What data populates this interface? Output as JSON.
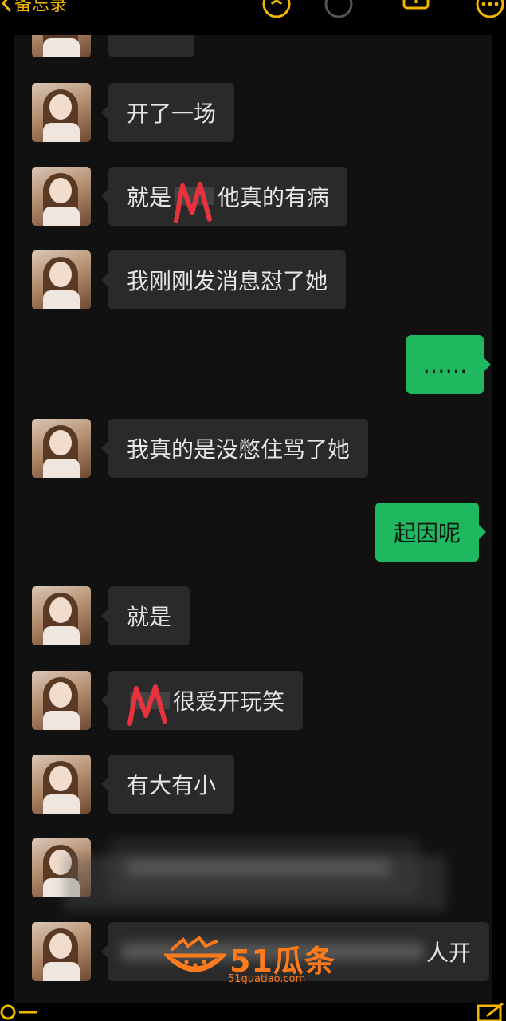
{
  "toolbar": {
    "back_label": "备忘录",
    "icons": [
      "undo-icon",
      "redo-icon",
      "share-icon",
      "more-icon"
    ]
  },
  "chat": {
    "messages": [
      {
        "side": "left",
        "text": "开了一场"
      },
      {
        "side": "left",
        "text_before": "就是",
        "text_after": "他真的有病",
        "redacted": true
      },
      {
        "side": "left",
        "text": "我刚刚发消息怼了她"
      },
      {
        "side": "right",
        "text": "……"
      },
      {
        "side": "left",
        "text": "我真的是没憋住骂了她"
      },
      {
        "side": "right",
        "text": "起因呢"
      },
      {
        "side": "left",
        "text": "就是"
      },
      {
        "side": "left",
        "text_before": "",
        "text_after": "很爱开玩笑",
        "redacted": true
      },
      {
        "side": "left",
        "text": "有大有小"
      },
      {
        "side": "left",
        "text": "",
        "blurred": true
      },
      {
        "side": "left",
        "text_tail": "人开",
        "blurred": true
      }
    ]
  },
  "watermark": {
    "brand": "51瓜条",
    "url": "51guatiao.com"
  },
  "colors": {
    "accent": "#f1b600",
    "bubble_in": "#2a2a2a",
    "bubble_out": "#1fb85f",
    "watermark": "#ff7a1a",
    "redaction_mark": "#e8323c"
  }
}
